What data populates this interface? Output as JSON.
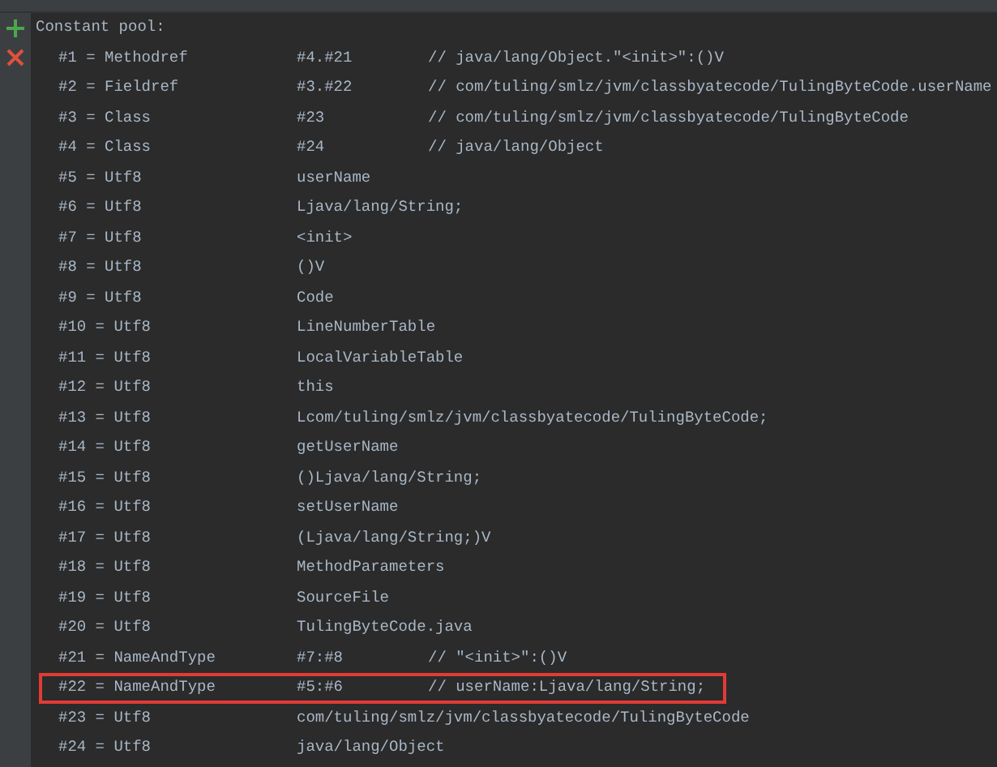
{
  "gutter": {
    "buttons": [
      {
        "kind": "add"
      },
      {
        "kind": "close"
      }
    ]
  },
  "header": "Constant pool:",
  "rows": [
    {
      "entry": "#1 = Methodref",
      "ref": "#4.#21",
      "comment": "// java/lang/Object.\"<init>\":()V",
      "highlighted": false
    },
    {
      "entry": "#2 = Fieldref",
      "ref": "#3.#22",
      "comment": "// com/tuling/smlz/jvm/classbyatecode/TulingByteCode.userName",
      "highlighted": false
    },
    {
      "entry": "#3 = Class",
      "ref": "#23",
      "comment": "// com/tuling/smlz/jvm/classbyatecode/TulingByteCode",
      "highlighted": false
    },
    {
      "entry": "#4 = Class",
      "ref": "#24",
      "comment": "// java/lang/Object",
      "highlighted": false
    },
    {
      "entry": "#5 = Utf8",
      "ref": "userName",
      "highlighted": false
    },
    {
      "entry": "#6 = Utf8",
      "ref": "Ljava/lang/String;",
      "highlighted": false
    },
    {
      "entry": "#7 = Utf8",
      "ref": "<init>",
      "highlighted": false
    },
    {
      "entry": "#8 = Utf8",
      "ref": "()V",
      "highlighted": false
    },
    {
      "entry": "#9 = Utf8",
      "ref": "Code",
      "highlighted": false
    },
    {
      "entry": "#10 = Utf8",
      "ref": "LineNumberTable",
      "highlighted": false
    },
    {
      "entry": "#11 = Utf8",
      "ref": "LocalVariableTable",
      "highlighted": false
    },
    {
      "entry": "#12 = Utf8",
      "ref": "this",
      "highlighted": false
    },
    {
      "entry": "#13 = Utf8",
      "ref": "Lcom/tuling/smlz/jvm/classbyatecode/TulingByteCode;",
      "highlighted": false
    },
    {
      "entry": "#14 = Utf8",
      "ref": "getUserName",
      "highlighted": false
    },
    {
      "entry": "#15 = Utf8",
      "ref": "()Ljava/lang/String;",
      "highlighted": false
    },
    {
      "entry": "#16 = Utf8",
      "ref": "setUserName",
      "highlighted": false
    },
    {
      "entry": "#17 = Utf8",
      "ref": "(Ljava/lang/String;)V",
      "highlighted": false
    },
    {
      "entry": "#18 = Utf8",
      "ref": "MethodParameters",
      "highlighted": false
    },
    {
      "entry": "#19 = Utf8",
      "ref": "SourceFile",
      "highlighted": false
    },
    {
      "entry": "#20 = Utf8",
      "ref": "TulingByteCode.java",
      "highlighted": false
    },
    {
      "entry": "#21 = NameAndType",
      "ref": "#7:#8",
      "comment": "// \"<init>\":()V",
      "highlighted": false
    },
    {
      "entry": "#22 = NameAndType",
      "ref": "#5:#6",
      "comment": "// userName:Ljava/lang/String;",
      "highlighted": true
    },
    {
      "entry": "#23 = Utf8",
      "ref": "com/tuling/smlz/jvm/classbyatecode/TulingByteCode",
      "highlighted": false
    },
    {
      "entry": "#24 = Utf8",
      "ref": "java/lang/Object",
      "highlighted": false
    }
  ]
}
